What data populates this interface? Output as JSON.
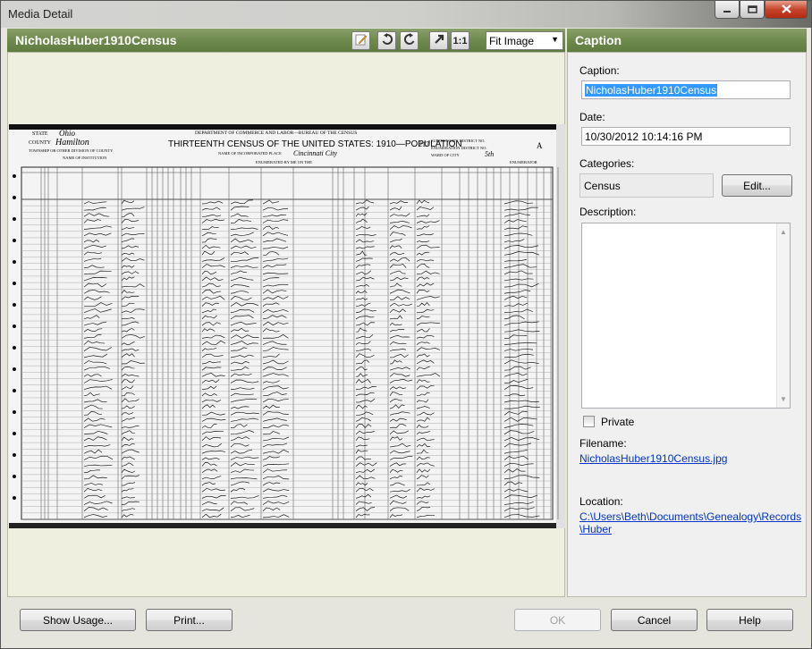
{
  "window": {
    "title": "Media Detail",
    "controls": {
      "minimize_icon": "minimize-icon",
      "maximize_icon": "maximize-icon",
      "close_icon": "close-icon"
    }
  },
  "viewer": {
    "header_title": "NicholasHuber1910Census",
    "toolbar": {
      "edit_icon": "edit-icon",
      "rotate_left_icon": "rotate-left-icon",
      "rotate_right_icon": "rotate-right-icon",
      "fit_toggle_icon": "expand-icon",
      "actual_size_label": "1:1",
      "zoom_select_value": "Fit Image"
    },
    "document": {
      "state_label": "STATE",
      "state_value": "Ohio",
      "county_label": "COUNTY",
      "county_value": "Hamilton",
      "township_label": "TOWNSHIP OR OTHER DIVISION OF COUNTY",
      "institution_label": "NAME OF INSTITUTION",
      "department": "DEPARTMENT OF COMMERCE AND LABOR—BUREAU OF THE CENSUS",
      "heading": "THIRTEENTH CENSUS OF THE UNITED STATES: 1910—POPULATION",
      "sheet_number": "217",
      "incorporated_place_label": "NAME OF INCORPORATED PLACE",
      "city_value": "Cincinnati City",
      "enumerated_label": "ENUMERATED BY ME ON THE",
      "supervisor_label": "SUPERVISOR'S DISTRICT NO.",
      "enumeration_label": "ENUMERATION DISTRICT NO.",
      "ward_label": "WARD OF CITY",
      "ward_value": "5th",
      "sheet_letter": "A",
      "enumerator_label": "ENUMERATOR",
      "column_headers": [
        "LOCATION.",
        "NAME",
        "RELATION.",
        "PERSONAL DESCRIPTION.",
        "NATIVITY.",
        "CITIZENSHIP.",
        "OCCUPATION.",
        "EDUCATION.",
        "OWNERSHIP OF HOME."
      ],
      "row_count": 50
    }
  },
  "caption_panel": {
    "header_title": "Caption",
    "caption_label": "Caption:",
    "caption_value": "NicholasHuber1910Census",
    "date_label": "Date:",
    "date_value": "10/30/2012 10:14:16 PM",
    "categories_label": "Categories:",
    "categories_value": "Census",
    "edit_button": "Edit...",
    "description_label": "Description:",
    "description_value": "",
    "private_label": "Private",
    "private_checked": false,
    "filename_label": "Filename:",
    "filename_value": "NicholasHuber1910Census.jpg",
    "location_label": "Location:",
    "location_value_line1": "C:\\Users\\Beth\\Documents\\Genealogy\\Records",
    "location_value_line2": "\\Huber"
  },
  "buttons": {
    "show_usage": "Show Usage...",
    "print": "Print...",
    "ok": "OK",
    "cancel": "Cancel",
    "help": "Help"
  },
  "colors": {
    "header_green": "#6f8a4d",
    "link_blue": "#0033cc",
    "selection_blue": "#3399ff",
    "close_red": "#c6442a"
  }
}
